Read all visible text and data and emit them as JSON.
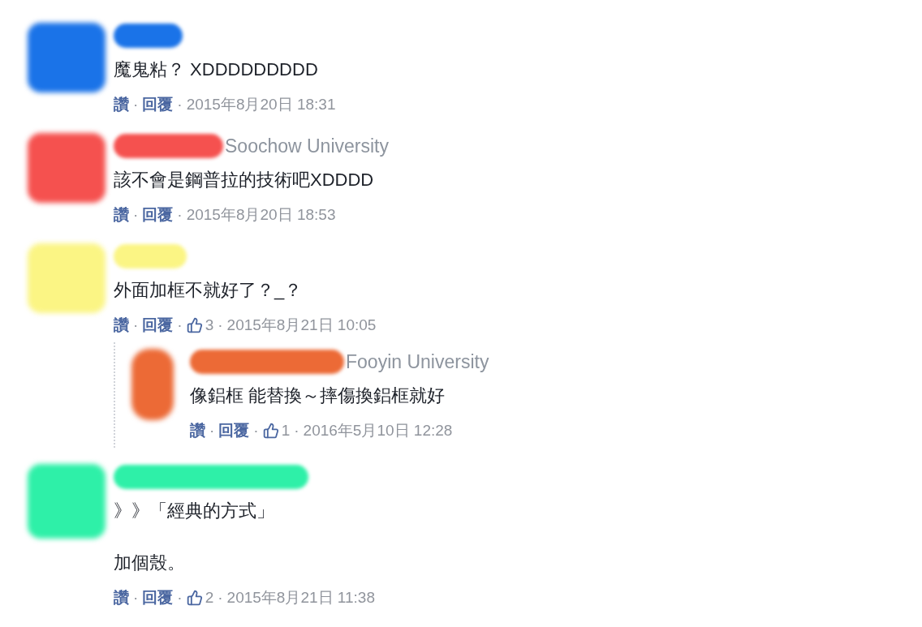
{
  "separator": "·",
  "comments": [
    {
      "color": "#1a73e8",
      "paragraphs": [
        "魔鬼粘？ XDDDDDDDDD"
      ],
      "actions": [
        {
          "kind": "link",
          "text": "讚"
        },
        {
          "kind": "link",
          "text": "回覆"
        },
        {
          "kind": "time",
          "text": "2015年8月20日 18:31"
        }
      ]
    },
    {
      "color": "#f5514f",
      "affiliation": "Soochow University",
      "paragraphs": [
        "該不會是鋼普拉的技術吧XDDDD"
      ],
      "actions": [
        {
          "kind": "link",
          "text": "讚"
        },
        {
          "kind": "link",
          "text": "回覆"
        },
        {
          "kind": "time",
          "text": "2015年8月20日 18:53"
        }
      ]
    },
    {
      "color": "#fbf584",
      "paragraphs": [
        "外面加框不就好了？_？"
      ],
      "actions": [
        {
          "kind": "link",
          "text": "讚"
        },
        {
          "kind": "link",
          "text": "回覆"
        },
        {
          "kind": "likes",
          "text": "3"
        },
        {
          "kind": "time",
          "text": "2015年8月21日 10:05"
        }
      ],
      "replies": [
        {
          "color": "#ec6a36",
          "affiliation": "Fooyin University",
          "paragraphs": [
            "像鋁框 能替換～摔傷換鋁框就好"
          ],
          "actions": [
            {
              "kind": "link",
              "text": "讚"
            },
            {
              "kind": "link",
              "text": "回覆"
            },
            {
              "kind": "likes",
              "text": "1"
            },
            {
              "kind": "time",
              "text": "2016年5月10日 12:28"
            }
          ]
        }
      ]
    },
    {
      "color": "#2ef0a8",
      "paragraphs": [
        "》》「經典的方式」",
        "加個殼。"
      ],
      "actions": [
        {
          "kind": "link",
          "text": "讚"
        },
        {
          "kind": "link",
          "text": "回覆"
        },
        {
          "kind": "likes",
          "text": "2"
        },
        {
          "kind": "time",
          "text": "2015年8月21日 11:38"
        }
      ]
    }
  ]
}
